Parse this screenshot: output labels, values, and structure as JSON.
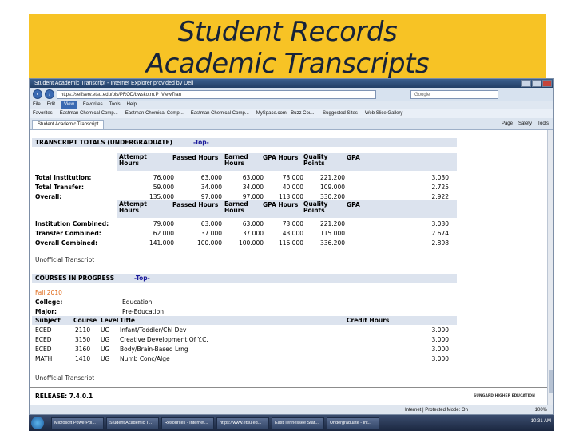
{
  "slide": {
    "title_line1": "Student Records",
    "title_line2": "Academic Transcripts"
  },
  "browser": {
    "window_title": "Student Academic Transcript - Internet Explorer provided by Dell",
    "url": "https://selfserv.etsu.edu/pls/PROD/bwskotrn.P_ViewTran",
    "search_placeholder": "Google",
    "menu": [
      "File",
      "Edit",
      "View",
      "Favorites",
      "Tools",
      "Help"
    ],
    "favorites": [
      "Favorites",
      "Eastman Chemical Comp...",
      "Eastman Chemical Comp...",
      "Eastman Chemical Comp...",
      "MySpace.com - Buzz Cou...",
      "Suggested Sites",
      "Web Slice Gallery"
    ],
    "tab_title": "Student Academic Transcript",
    "commands": [
      "Page",
      "Safety",
      "Tools"
    ],
    "status_zone": "Internet | Protected Mode: On",
    "zoom": "100%"
  },
  "transcript_totals": {
    "title": "TRANSCRIPT TOTALS (UNDERGRADUATE)",
    "top_link": "-Top-",
    "headers": [
      "Attempt Hours",
      "Passed Hours",
      "Earned Hours",
      "GPA Hours",
      "Quality Points",
      "GPA"
    ],
    "block1": [
      {
        "label": "Total Institution:",
        "values": [
          "76.000",
          "63.000",
          "63.000",
          "73.000",
          "221.200",
          "3.030"
        ]
      },
      {
        "label": "Total Transfer:",
        "values": [
          "59.000",
          "34.000",
          "34.000",
          "40.000",
          "109.000",
          "2.725"
        ]
      },
      {
        "label": "Overall:",
        "values": [
          "135.000",
          "97.000",
          "97.000",
          "113.000",
          "330.200",
          "2.922"
        ]
      }
    ],
    "block2": [
      {
        "label": "Institution Combined:",
        "values": [
          "79.000",
          "63.000",
          "63.000",
          "73.000",
          "221.200",
          "3.030"
        ]
      },
      {
        "label": "Transfer Combined:",
        "values": [
          "62.000",
          "37.000",
          "37.000",
          "43.000",
          "115.000",
          "2.674"
        ]
      },
      {
        "label": "Overall Combined:",
        "values": [
          "141.000",
          "100.000",
          "100.000",
          "116.000",
          "336.200",
          "2.898"
        ]
      }
    ],
    "unofficial_link": "Unofficial Transcript"
  },
  "courses_in_progress": {
    "title": "COURSES IN PROGRESS",
    "top_link": "-Top-",
    "term": "Fall 2010",
    "college_label": "College:",
    "college_value": "Education",
    "major_label": "Major:",
    "major_value": "Pre-Education",
    "headers": [
      "Subject",
      "Course",
      "Level",
      "Title",
      "Credit Hours"
    ],
    "rows": [
      {
        "subject": "ECED",
        "course": "2110",
        "level": "UG",
        "title": "Infant/Toddler/Chl Dev",
        "credit": "3.000"
      },
      {
        "subject": "ECED",
        "course": "3150",
        "level": "UG",
        "title": "Creative Development Of Y.C.",
        "credit": "3.000"
      },
      {
        "subject": "ECED",
        "course": "3160",
        "level": "UG",
        "title": "Body/Brain-Based Lrng",
        "credit": "3.000"
      },
      {
        "subject": "MATH",
        "course": "1410",
        "level": "UG",
        "title": "Numb Conc/Alge",
        "credit": "3.000"
      }
    ],
    "unofficial_link": "Unofficial Transcript"
  },
  "release": "RELEASE: 7.4.0.1",
  "footer_logo": "SUNGARD HIGHER EDUCATION",
  "taskbar": [
    "Microsoft PowerPoi...",
    "Student Academic T...",
    "Resources - Internet...",
    "https://www.etsu.ed...",
    "East Tennessee Stat...",
    "Undergraduate - Int..."
  ],
  "clock": "10:31 AM"
}
